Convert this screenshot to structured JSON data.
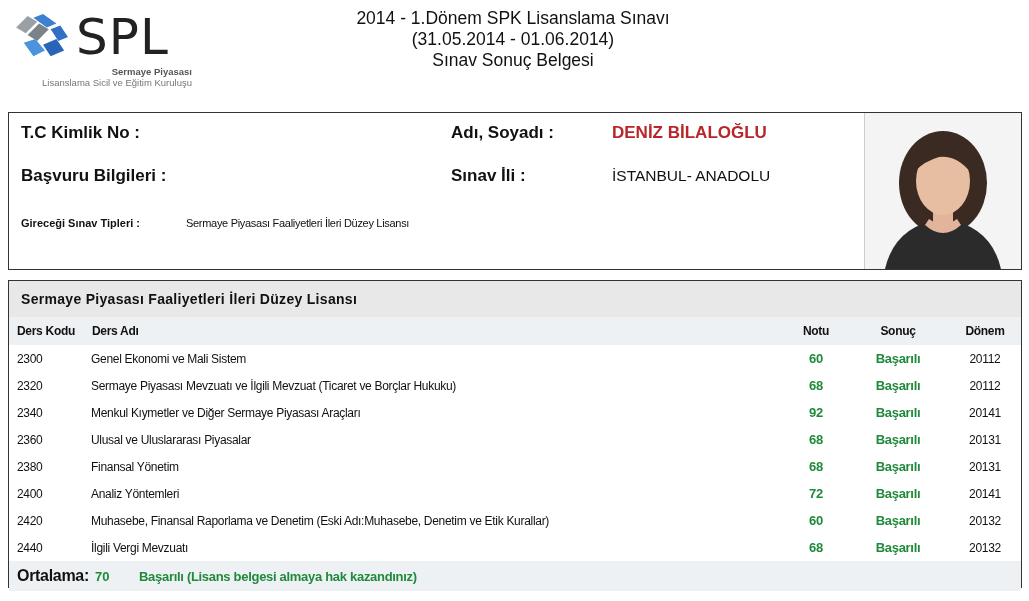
{
  "logo": {
    "wordmark": "SPL",
    "line_1": "Sermaye Piyasası",
    "line_2": "Lisanslama Sicil ve Eğitim Kuruluşu"
  },
  "title_lines": [
    "2014 - 1.Dönem SPK Lisanslama Sınavı",
    "(31.05.2014 - 01.06.2014)",
    "Sınav Sonuç Belgesi"
  ],
  "info": {
    "id_label": "T.C Kimlik No :",
    "name_label": "Adı, Soyadı :",
    "name_value": "DENİZ BİLALOĞLU",
    "application_label": "Başvuru Bilgileri :",
    "city_label": "Sınav İli :",
    "city_value": "İSTANBUL- ANADOLU",
    "exam_types_label": "Gireceği Sınav Tipleri :",
    "exam_types_value": "Sermaye Piyasası Faaliyetleri İleri Düzey Lisansı"
  },
  "results": {
    "title": "Sermaye Piyasası Faaliyetleri İleri Düzey Lisansı",
    "columns": [
      "Ders Kodu",
      "Ders Adı",
      "Notu",
      "Sonuç",
      "Dönem"
    ],
    "rows": [
      {
        "code": "2300",
        "name": "Genel Ekonomi ve Mali Sistem",
        "grade": "60",
        "result": "Başarılı",
        "term": "20112"
      },
      {
        "code": "2320",
        "name": "Sermaye Piyasası Mevzuatı ve İlgili Mevzuat (Ticaret ve Borçlar Hukuku)",
        "grade": "68",
        "result": "Başarılı",
        "term": "20112"
      },
      {
        "code": "2340",
        "name": "Menkul Kıymetler ve Diğer Sermaye Piyasası Araçları",
        "grade": "92",
        "result": "Başarılı",
        "term": "20141"
      },
      {
        "code": "2360",
        "name": "Ulusal ve Uluslararası Piyasalar",
        "grade": "68",
        "result": "Başarılı",
        "term": "20131"
      },
      {
        "code": "2380",
        "name": "Finansal Yönetim",
        "grade": "68",
        "result": "Başarılı",
        "term": "20131"
      },
      {
        "code": "2400",
        "name": "Analiz Yöntemleri",
        "grade": "72",
        "result": "Başarılı",
        "term": "20141"
      },
      {
        "code": "2420",
        "name": "Muhasebe, Finansal Raporlama ve Denetim (Eski Adı:Muhasebe, Denetim ve Etik Kurallar)",
        "grade": "60",
        "result": "Başarılı",
        "term": "20132"
      },
      {
        "code": "2440",
        "name": "İlgili Vergi Mevzuatı",
        "grade": "68",
        "result": "Başarılı",
        "term": "20132"
      }
    ],
    "average_label": "Ortalama:",
    "average_value": "70",
    "average_result": "Başarılı (Lisans belgesi almaya hak kazandınız)"
  }
}
